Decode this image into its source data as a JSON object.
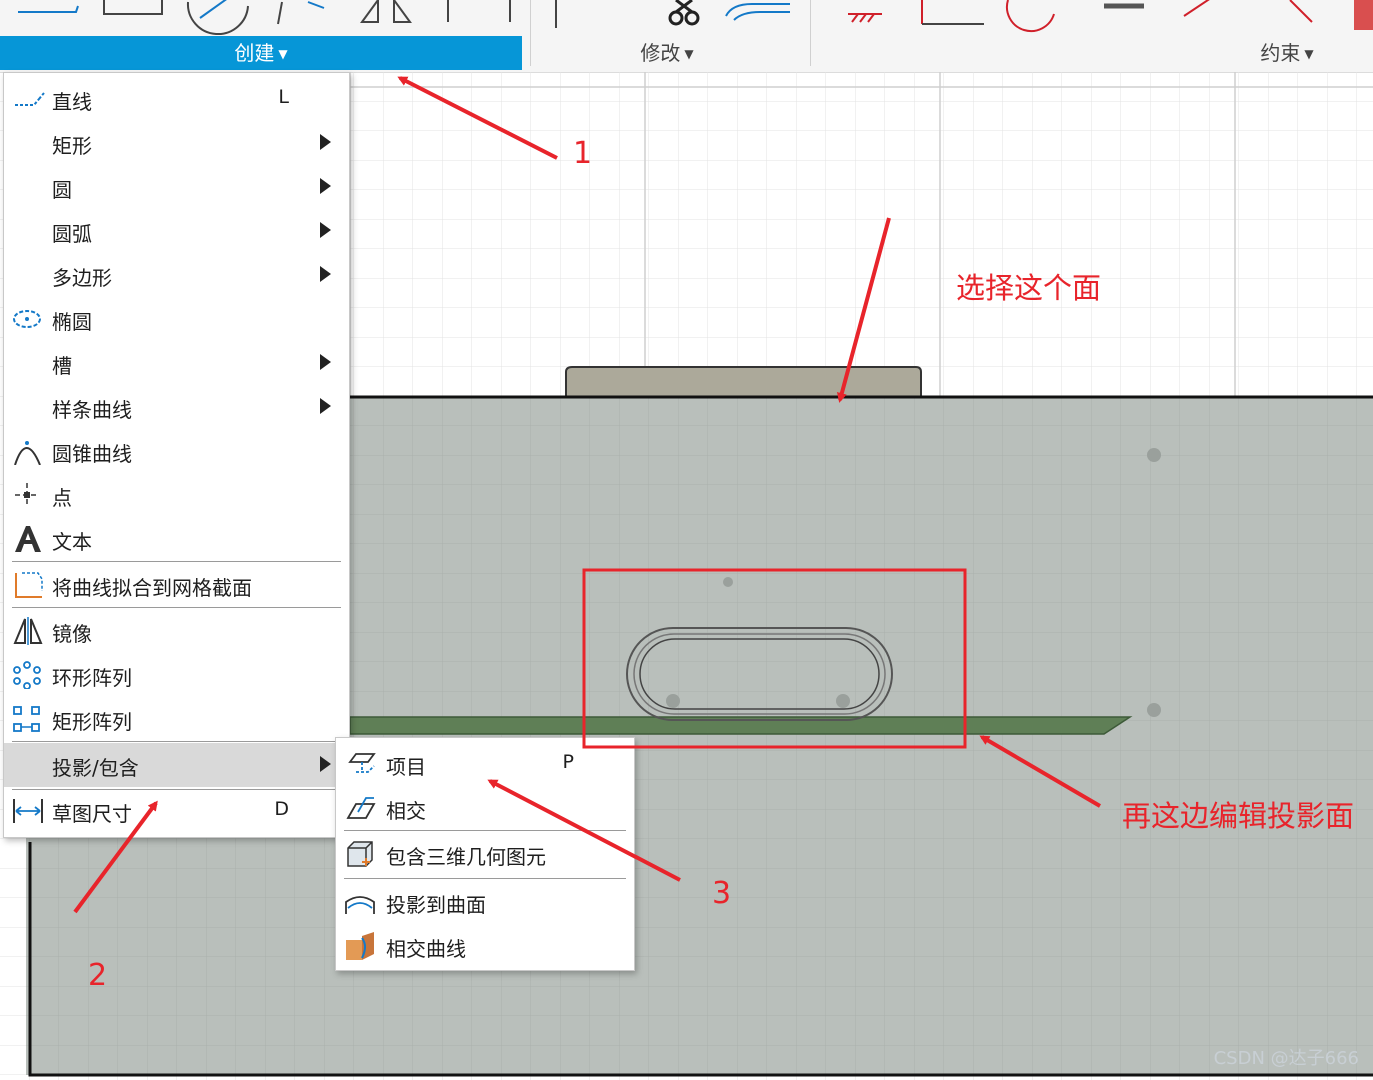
{
  "toolbar": {
    "tabs": {
      "create": "创建",
      "modify": "修改",
      "constraints": "约束"
    },
    "caret": "▼",
    "icons": [
      "line-icon",
      "rectangle-icon",
      "circle-icon",
      "arc-icon",
      "mirror-icon",
      "trim-icon",
      "fillet-icon",
      "coincident-icon",
      "perpendicular-icon",
      "horizontal-icon",
      "tangent-icon",
      "parallel-icon"
    ]
  },
  "create_menu": {
    "items": [
      {
        "label": "直线",
        "shortcut": "L",
        "icon": "line-icon"
      },
      {
        "label": "矩形",
        "submenu": true
      },
      {
        "label": "圆",
        "submenu": true
      },
      {
        "label": "圆弧",
        "submenu": true
      },
      {
        "label": "多边形",
        "submenu": true
      },
      {
        "label": "椭圆",
        "icon": "ellipse-icon"
      },
      {
        "label": "槽",
        "submenu": true
      },
      {
        "label": "样条曲线",
        "submenu": true
      },
      {
        "label": "圆锥曲线",
        "icon": "conic-icon"
      },
      {
        "label": "点",
        "icon": "point-icon"
      },
      {
        "label": "文本",
        "icon": "text-icon"
      },
      {
        "label": "将曲线拟合到网格截面",
        "icon": "fit-curve-icon"
      },
      {
        "label": "镜像",
        "icon": "mirror-icon"
      },
      {
        "label": "环形阵列",
        "icon": "circular-pattern-icon"
      },
      {
        "label": "矩形阵列",
        "icon": "rect-pattern-icon"
      },
      {
        "label": "投影/包含",
        "submenu": true,
        "highlighted": true
      },
      {
        "label": "草图尺寸",
        "shortcut": "D",
        "icon": "dimension-icon"
      }
    ]
  },
  "project_submenu": {
    "items": [
      {
        "label": "项目",
        "shortcut": "P",
        "icon": "project-icon"
      },
      {
        "label": "相交",
        "icon": "intersect-icon"
      },
      {
        "label": "包含三维几何图元",
        "icon": "include-3d-icon"
      },
      {
        "label": "投影到曲面",
        "icon": "project-surface-icon"
      },
      {
        "label": "相交曲线",
        "icon": "intersection-curve-icon"
      }
    ]
  },
  "annotations": {
    "select_face": "选择这个面",
    "edit_projection": "再这边编辑投影面",
    "step1": "1",
    "step2": "2",
    "step3": "3",
    "accent_color": "#e8242b"
  },
  "watermark": "CSDN @达子666",
  "colors": {
    "tab_active": "#0696d7",
    "body_face": "#b9bfbb",
    "grid": "#dcdcdc"
  }
}
